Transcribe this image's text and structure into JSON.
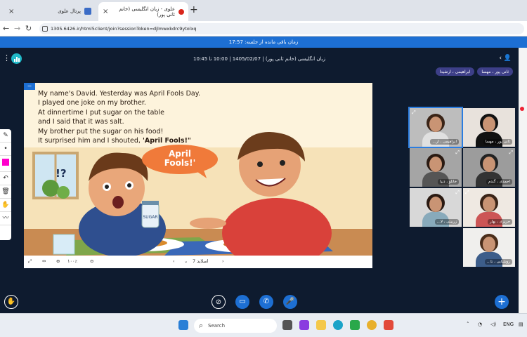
{
  "browser": {
    "tabs": [
      {
        "title": "پرتال علوی",
        "active": false
      },
      {
        "title": "علوی - زبان انگلیسی (خانم ثانی پور)",
        "active": true
      }
    ],
    "url": "1305.6426.ir/html5client/join?sessionToken=djlmwxkdrc9ytolxq"
  },
  "meeting": {
    "time_left_label": "زمان باقی مانده از جلسه: 17:57",
    "title": "زبان انگلیسی (خانم ثانی پور) | 1405/02/07 | 10:00 تا 10:45",
    "badges": [
      "ثانی پور ، مهسا",
      "ابراهیمی ، ارشیدا"
    ],
    "accent_color": "#1d6fd3"
  },
  "slide": {
    "lines": [
      "My name's David. Yesterday was April Fools Day.",
      "I played one joke on my brother.",
      "At dinnertime I put sugar on the table",
      "and I said that it was salt.",
      "My brother put the sugar on his food!"
    ],
    "last_line_prefix": "It surprised him and I shouted, ",
    "last_line_quote": "'April Fools!\"",
    "bubble_line1": "April",
    "bubble_line2": "Fools!'",
    "exclaim": "!?",
    "jar_label": "SUGAR",
    "slide_label": "اسلاید 7",
    "zoom_label": "۱۰۰٪"
  },
  "cameras": [
    {
      "name": "ابراهیمی ، ار...",
      "selected": true
    },
    {
      "name": "ثانی پور ، مهسا",
      "selected": false
    },
    {
      "name": "خانلو ، دنیا",
      "selected": false
    },
    {
      "name": "احمدی ، گندم",
      "selected": false
    },
    {
      "name": "زربینی ، لا...",
      "selected": false
    },
    {
      "name": "حریری ، بهار",
      "selected": false
    },
    {
      "name": "روشنایی ، نا...",
      "selected": false
    }
  ],
  "taskbar": {
    "search_placeholder": "Search",
    "lang": "ENG"
  }
}
